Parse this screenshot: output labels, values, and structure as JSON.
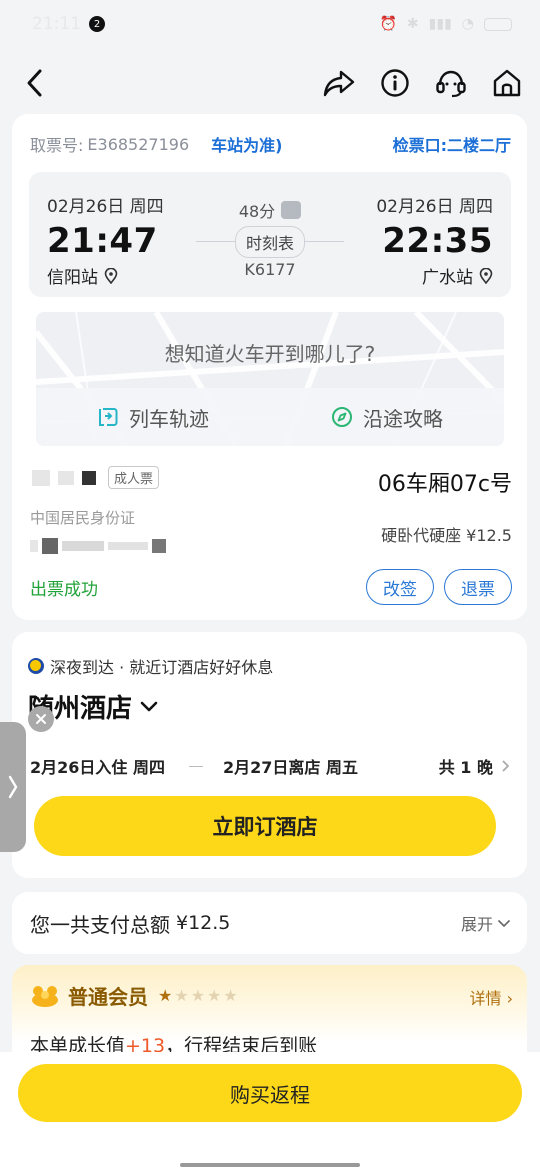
{
  "status_bar": {
    "time": "21:11",
    "notification_count": "2",
    "battery": "27"
  },
  "ticket": {
    "pickup_label": "取票号:",
    "pickup_code": "E368527196",
    "pickup_note": "车站为准)",
    "gate": "检票口:二楼二厅",
    "departure": {
      "date": "02月26日 周四",
      "time": "21:47",
      "station": "信阳站"
    },
    "arrival": {
      "date": "02月26日 周四",
      "time": "22:35",
      "station": "广水站"
    },
    "duration": "48分",
    "schedule_label": "时刻表",
    "train_no": "K6177",
    "map_question": "想知道火车开到哪儿了?",
    "track_label": "列车轨迹",
    "guide_label": "沿途攻略",
    "passenger_type": "成人票",
    "seat": "06车厢07c号",
    "id_type": "中国居民身份证",
    "seat_type": "硬卧代硬座 ¥12.5",
    "status": "出票成功",
    "change_label": "改签",
    "refund_label": "退票"
  },
  "hotel": {
    "tip": "深夜到达 · 就近订酒店好好休息",
    "city": "随州酒店",
    "checkin": "2月26日入住 周四",
    "checkout": "2月27日离店 周五",
    "nights": "共 1 晚",
    "book_label": "立即订酒店"
  },
  "payment": {
    "label": "您一共支付总额",
    "amount": "¥12.5",
    "expand_label": "展开"
  },
  "member": {
    "title": "普通会员",
    "stars_filled": 1,
    "stars_total": 5,
    "detail_label": "详情",
    "growth_prefix": "本单成长值",
    "growth_value": "+13",
    "growth_suffix": "，行程结束后到账"
  },
  "return_label": "购买返程",
  "colors": {
    "accent_yellow": "#fcd818",
    "link_blue": "#1b6fd6",
    "success_green": "#22a33a"
  }
}
